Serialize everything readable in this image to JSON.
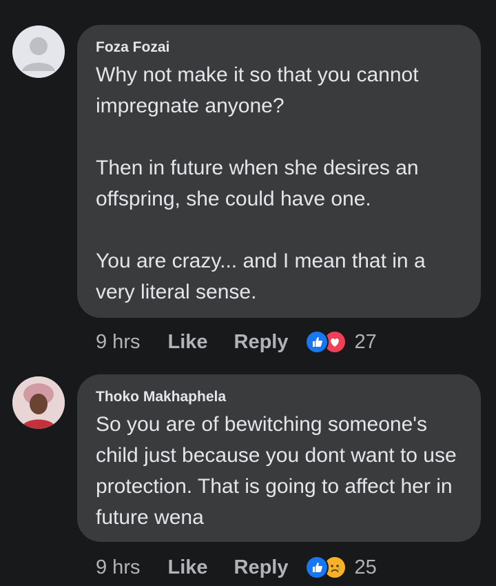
{
  "comments": [
    {
      "author": "Foza Fozai",
      "text": "Why not make it so that you cannot impregnate anyone?\n\nThen in future when she desires an offspring, she could have one.\n\nYou are crazy... and I mean that in a very literal sense.",
      "time": "9 hrs",
      "like_label": "Like",
      "reply_label": "Reply",
      "reactions": [
        "like-icon",
        "love-icon"
      ],
      "reaction_count": "27"
    },
    {
      "author": "Thoko Makhaphela",
      "text": "So you are of bewitching someone's child just because you dont want to use protection. That is going to affect her in future wena",
      "time": "9 hrs",
      "like_label": "Like",
      "reply_label": "Reply",
      "reactions": [
        "like-icon",
        "sad-icon"
      ],
      "reaction_count": "25"
    }
  ],
  "colors": {
    "background": "#18191a",
    "bubble": "#3a3b3c",
    "like_blue": "#1877f2",
    "love_red": "#f33e58",
    "sad_yellow": "#f7b125"
  }
}
